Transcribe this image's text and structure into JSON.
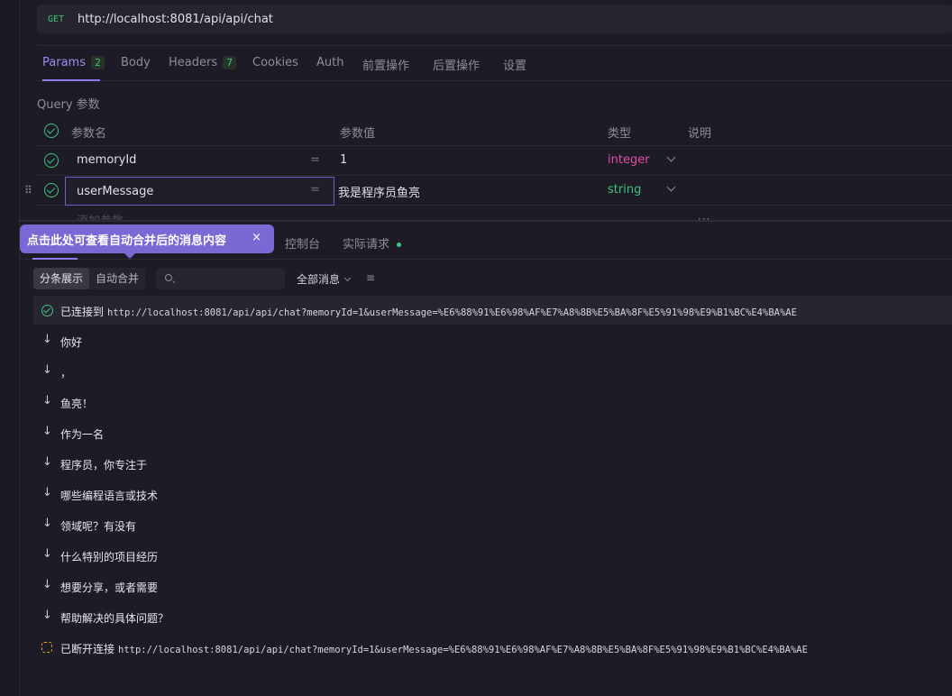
{
  "request": {
    "method": "GET",
    "url": "http://localhost:8081/api/api/chat"
  },
  "tabs": [
    {
      "label": "Params",
      "badge": "2"
    },
    {
      "label": "Body"
    },
    {
      "label": "Headers",
      "badge": "7"
    },
    {
      "label": "Cookies"
    },
    {
      "label": "Auth"
    },
    {
      "label": "前置操作"
    },
    {
      "label": "后置操作"
    },
    {
      "label": "设置"
    }
  ],
  "query": {
    "title": "Query 参数",
    "headers": {
      "name": "参数名",
      "value": "参数值",
      "type": "类型",
      "desc": "说明"
    },
    "rows": [
      {
        "name": "memoryId",
        "value": "1",
        "type": "integer"
      },
      {
        "name": "userMessage",
        "value": "我是程序员鱼亮",
        "type": "string"
      }
    ],
    "eq": "=",
    "add_placeholder": "添加参数"
  },
  "tooltip": {
    "text": "点击此处可查看自动合并后的消息内容",
    "close": "×"
  },
  "response_tabs": [
    {
      "label": "控制台"
    },
    {
      "label": "实际请求"
    }
  ],
  "toolbar": {
    "split_label": "分条展示",
    "merge_label": "自动合并",
    "search_placeholder": "",
    "filter_label": "全部消息",
    "sort_icon": "≡"
  },
  "connection": {
    "connected_label": "已连接到",
    "connected_url": "http://localhost:8081/api/api/chat?memoryId=1&userMessage=%E6%88%91%E6%98%AF%E7%A8%8B%E5%BA%8F%E5%91%98%E9%B1%BC%E4%BA%AE",
    "disconnected_label": "已断开连接",
    "disconnected_url": "http://localhost:8081/api/api/chat?memoryId=1&userMessage=%E6%88%91%E6%98%AF%E7%A8%8B%E5%BA%8F%E5%91%98%E9%B1%BC%E4%BA%AE"
  },
  "messages": [
    "你好",
    "，",
    "鱼亮！",
    "作为一名",
    "程序员，你专注于",
    "哪些编程语言或技术",
    "领域呢？有没有",
    "什么特别的项目经历",
    "想要分享，或者需要",
    "帮助解决的具体问题？"
  ],
  "icons": {
    "arrow": "arrow-down-icon",
    "check": "check-circle-icon"
  }
}
